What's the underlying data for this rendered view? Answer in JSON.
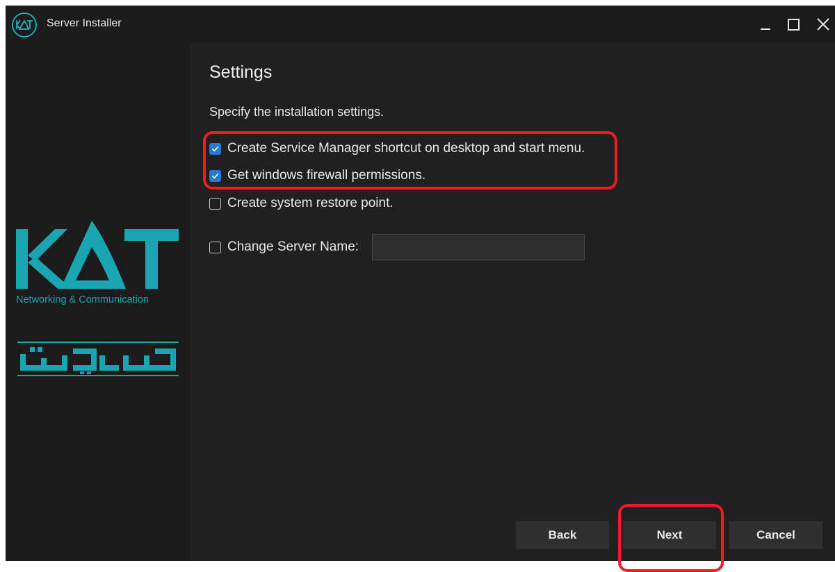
{
  "window": {
    "title": "Server Installer",
    "controls": {
      "minimize": "minimize-icon",
      "maximize": "maximize-icon",
      "close": "close-icon"
    }
  },
  "sidebar": {
    "logo_text": "KDT",
    "tagline": "Networking & Communication",
    "persian_logo": "کی دی تی"
  },
  "page": {
    "heading": "Settings",
    "description": "Specify the installation settings."
  },
  "options": [
    {
      "label": "Create Service Manager shortcut on desktop and start menu.",
      "checked": true
    },
    {
      "label": "Get windows firewall permissions.",
      "checked": true
    },
    {
      "label": "Create system restore point.",
      "checked": false
    },
    {
      "label": "Change Server Name:",
      "checked": false
    }
  ],
  "server_name": {
    "value": "",
    "placeholder": ""
  },
  "buttons": {
    "back": "Back",
    "next": "Next",
    "cancel": "Cancel"
  },
  "colors": {
    "accent": "#2b77d4",
    "brand_teal": "#1aa5b3",
    "highlight": "#ee1c25",
    "background": "#202020"
  }
}
